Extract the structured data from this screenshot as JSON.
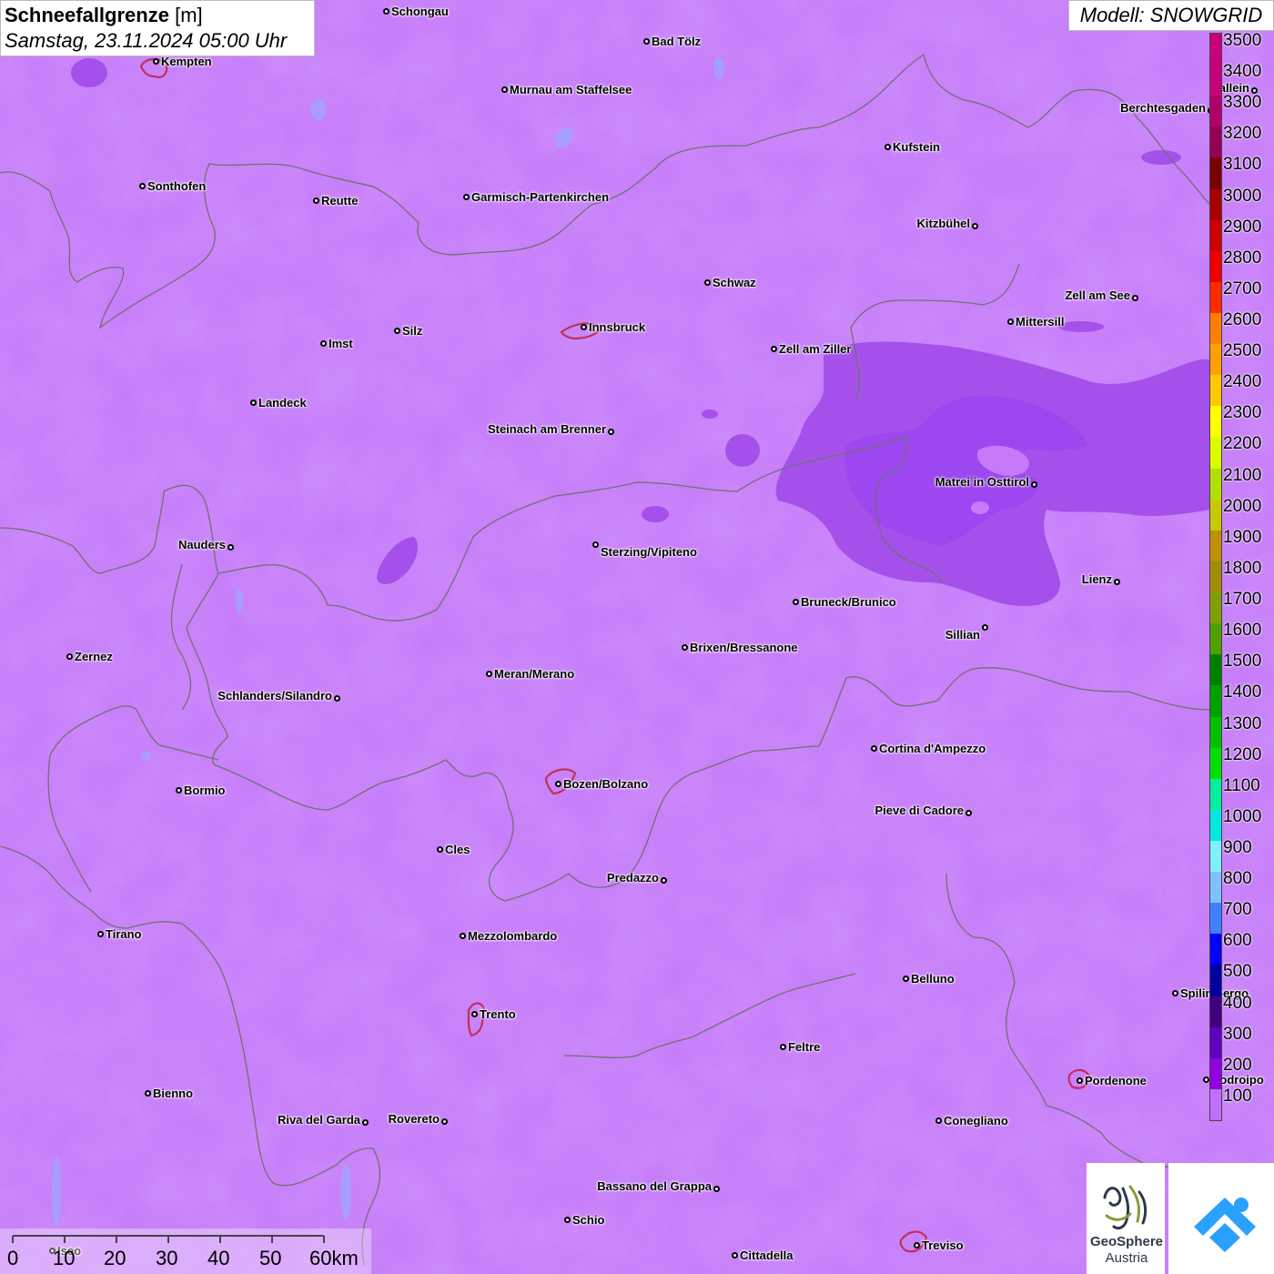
{
  "title": {
    "main": "Schneefallgrenze",
    "unit": "[m]",
    "datetime": "Samstag, 23.11.2024 05:00 Uhr"
  },
  "model_label": "Modell: SNOWGRID",
  "legend": {
    "labels": [
      "3500",
      "3400",
      "3300",
      "3200",
      "3100",
      "3000",
      "2900",
      "2800",
      "2700",
      "2600",
      "2500",
      "2400",
      "2300",
      "2200",
      "2100",
      "2000",
      "1900",
      "1800",
      "1700",
      "1600",
      "1500",
      "1400",
      "1300",
      "1200",
      "1100",
      "1000",
      "900",
      "800",
      "700",
      "600",
      "500",
      "400",
      "300",
      "200",
      "100"
    ],
    "colors": [
      "#c8007a",
      "#c8007a",
      "#b0006a",
      "#980058",
      "#7a0000",
      "#a80000",
      "#cc0000",
      "#ee0000",
      "#ff2a00",
      "#ff7f00",
      "#ffa000",
      "#ffc800",
      "#ffff00",
      "#d8ff00",
      "#b0e000",
      "#c8c800",
      "#c09000",
      "#a08c00",
      "#80a000",
      "#50a000",
      "#008000",
      "#00a000",
      "#00c000",
      "#00e000",
      "#00f0a0",
      "#00e8e0",
      "#80f0ff",
      "#80c0ff",
      "#4080ff",
      "#0000ff",
      "#0000a0",
      "#400080",
      "#6000c0",
      "#9000e0",
      "#c070ff"
    ]
  },
  "cities": [
    {
      "name": "Schongau"
    },
    {
      "name": "Bad Tölz"
    },
    {
      "name": "Kempten"
    },
    {
      "name": "Murnau am Staffelsee"
    },
    {
      "name": "Hallein"
    },
    {
      "name": "Berchtesgaden"
    },
    {
      "name": "Kufstein"
    },
    {
      "name": "Sonthofen"
    },
    {
      "name": "Reutte"
    },
    {
      "name": "Garmisch-Partenkirchen"
    },
    {
      "name": "Kitzbühel"
    },
    {
      "name": "Schwaz"
    },
    {
      "name": "Zell am See"
    },
    {
      "name": "Innsbruck"
    },
    {
      "name": "Mittersill"
    },
    {
      "name": "Imst"
    },
    {
      "name": "Silz"
    },
    {
      "name": "Zell am Ziller"
    },
    {
      "name": "Landeck"
    },
    {
      "name": "Steinach am Brenner"
    },
    {
      "name": "Matrei in Osttirol"
    },
    {
      "name": "Nauders"
    },
    {
      "name": "Sterzing/Vipiteno"
    },
    {
      "name": "Lienz"
    },
    {
      "name": "Bruneck/Brunico"
    },
    {
      "name": "Sillian"
    },
    {
      "name": "Zernez"
    },
    {
      "name": "Brixen/Bressanone"
    },
    {
      "name": "Meran/Merano"
    },
    {
      "name": "Schlanders/Silandro"
    },
    {
      "name": "Cortina d'Ampezzo"
    },
    {
      "name": "Bormio"
    },
    {
      "name": "Bozen/Bolzano"
    },
    {
      "name": "Pieve di Cadore"
    },
    {
      "name": "Cles"
    },
    {
      "name": "Predazzo"
    },
    {
      "name": "Tirano"
    },
    {
      "name": "Mezzolombardo"
    },
    {
      "name": "Belluno"
    },
    {
      "name": "Spilimbergo"
    },
    {
      "name": "Trento"
    },
    {
      "name": "Feltre"
    },
    {
      "name": "Pordenone"
    },
    {
      "name": "Bienno"
    },
    {
      "name": "Riva del Garda"
    },
    {
      "name": "Rovereto"
    },
    {
      "name": "Conegliano"
    },
    {
      "name": "Bassano del Grappa"
    },
    {
      "name": "Schio"
    },
    {
      "name": "Treviso"
    },
    {
      "name": "Cittadella"
    },
    {
      "name": "Codroipo"
    },
    {
      "name": "Iseo"
    }
  ],
  "scalebar": {
    "labels": [
      "0",
      "10",
      "20",
      "30",
      "40",
      "50",
      "60km"
    ]
  },
  "logos": {
    "geosphere_line1": "GeoSphere",
    "geosphere_line2": "Austria"
  },
  "colors": {
    "map_base": "#c57af9",
    "snowline_200": "#a550ea",
    "snowline_100": "#c57af9",
    "snowline_300": "#9a45f0",
    "border": "#707070"
  }
}
